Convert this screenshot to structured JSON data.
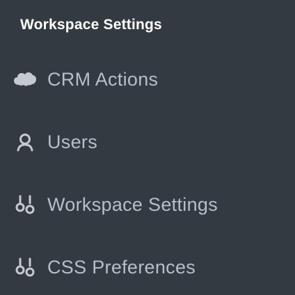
{
  "header": {
    "title": "Workspace Settings"
  },
  "nav": {
    "items": [
      {
        "label": "CRM Actions",
        "icon": "cloud-icon"
      },
      {
        "label": "Users",
        "icon": "user-icon"
      },
      {
        "label": "Workspace Settings",
        "icon": "sliders-icon"
      },
      {
        "label": "CSS Preferences",
        "icon": "sliders-icon"
      }
    ]
  },
  "colors": {
    "background": "#343a42",
    "title": "#ffffff",
    "item_text": "#b8bec7"
  }
}
